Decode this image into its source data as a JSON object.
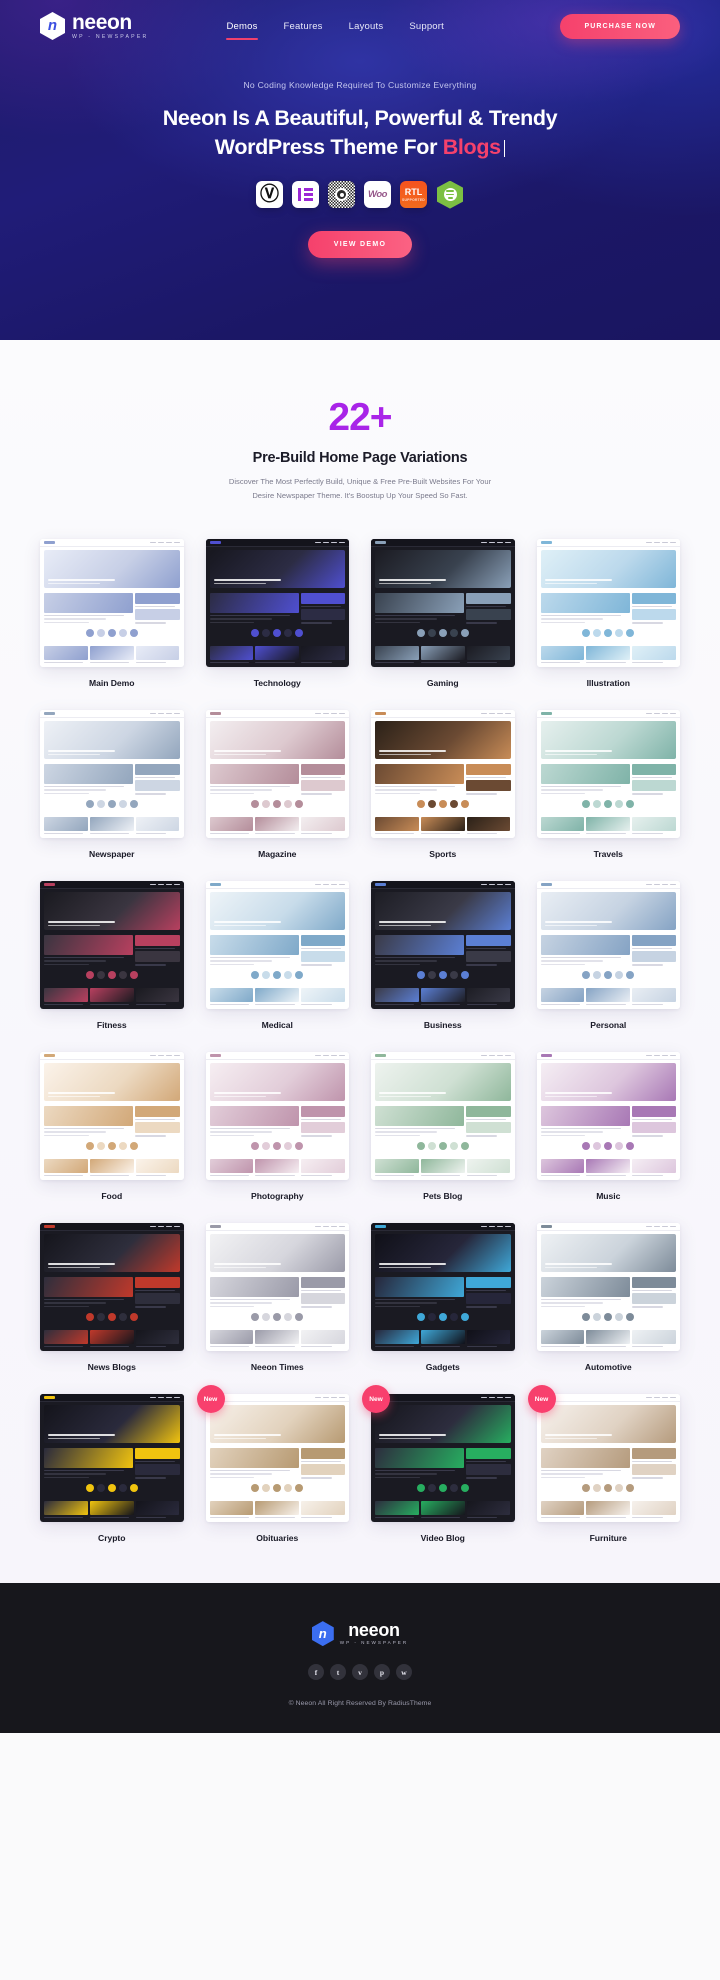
{
  "nav": {
    "brand": {
      "name": "neeon",
      "tagline": "WP - NEWSPAPER",
      "mark_letter": "n"
    },
    "links": [
      {
        "label": "Demos",
        "active": true
      },
      {
        "label": "Features",
        "active": false
      },
      {
        "label": "Layouts",
        "active": false
      },
      {
        "label": "Support",
        "active": false
      }
    ],
    "cta": "PURCHASE NOW"
  },
  "hero": {
    "eyebrow": "No Coding Knowledge Required To Customize Everything",
    "title_line1": "Neeon Is A Beautiful, Powerful & Trendy",
    "title_line2_prefix": "WordPress Theme For ",
    "title_accent": "Blogs",
    "tech_icons": [
      {
        "name": "wordpress-icon",
        "label": "W"
      },
      {
        "name": "elementor-icon",
        "label": "E"
      },
      {
        "name": "gutenberg-icon",
        "label": "G"
      },
      {
        "name": "woocommerce-icon",
        "label": "Woo"
      },
      {
        "name": "rtl-icon",
        "label": "RTL",
        "sub": "SUPPORTED"
      },
      {
        "name": "hexagon-menu-icon",
        "label": ""
      }
    ],
    "cta": "VIEW DEMO",
    "accent_color": "#f5416c",
    "bg_color": "#1e1b69"
  },
  "demos": {
    "count": "22+",
    "title": "Pre-Build Home Page Variations",
    "subtitle_line1": "Discover The Most Perfectly Build, Unique & Free Pre-Built Websites For Your",
    "subtitle_line2": "Desire Newspaper Theme. It's Boostup Up Your Speed So Fast.",
    "count_color": "#a31fe6",
    "items": [
      {
        "label": "Main Demo",
        "new": false
      },
      {
        "label": "Technology",
        "new": false
      },
      {
        "label": "Gaming",
        "new": false
      },
      {
        "label": "Illustration",
        "new": false
      },
      {
        "label": "Newspaper",
        "new": false
      },
      {
        "label": "Magazine",
        "new": false
      },
      {
        "label": "Sports",
        "new": false
      },
      {
        "label": "Travels",
        "new": false
      },
      {
        "label": "Fitness",
        "new": false
      },
      {
        "label": "Medical",
        "new": false
      },
      {
        "label": "Business",
        "new": false
      },
      {
        "label": "Personal",
        "new": false
      },
      {
        "label": "Food",
        "new": false
      },
      {
        "label": "Photography",
        "new": false
      },
      {
        "label": "Pets Blog",
        "new": false
      },
      {
        "label": "Music",
        "new": false
      },
      {
        "label": "News Blogs",
        "new": false
      },
      {
        "label": "Neeon Times",
        "new": false
      },
      {
        "label": "Gadgets",
        "new": false
      },
      {
        "label": "Automotive",
        "new": false
      },
      {
        "label": "Crypto",
        "new": false
      },
      {
        "label": "Obituaries",
        "new": true
      },
      {
        "label": "Video Blog",
        "new": true
      },
      {
        "label": "Furniture",
        "new": true
      }
    ],
    "new_badge_label": "New"
  },
  "footer": {
    "brand": {
      "name": "neeon",
      "tagline": "WP - NEWSPAPER",
      "mark_letter": "n"
    },
    "socials": [
      {
        "name": "facebook-icon",
        "glyph": "f"
      },
      {
        "name": "twitter-icon",
        "glyph": "t"
      },
      {
        "name": "vimeo-icon",
        "glyph": "v"
      },
      {
        "name": "pinterest-icon",
        "glyph": "p"
      },
      {
        "name": "whatsapp-icon",
        "glyph": "w"
      }
    ],
    "copyright": "© Neeon All Right Reserved By RadiusTheme"
  }
}
